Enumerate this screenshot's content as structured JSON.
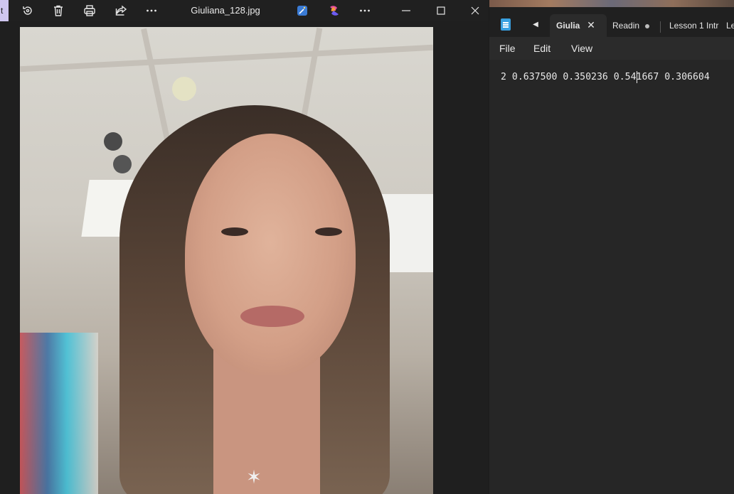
{
  "photos": {
    "title": "Giuliana_128.jpg",
    "left_accent_label": "t",
    "toolbar_icons": [
      "rotate-icon",
      "delete-icon",
      "print-icon",
      "share-icon",
      "more-icon"
    ],
    "enhance_icons": [
      "magic-wand-icon",
      "copilot-icon",
      "more-icon"
    ],
    "window_controls": [
      "minimize-icon",
      "maximize-icon",
      "close-icon"
    ]
  },
  "notepad": {
    "tabs": [
      {
        "label": "Giulia",
        "active": true
      },
      {
        "label": "Readin",
        "modified": true
      },
      {
        "label": "Lesson 1 Intr"
      },
      {
        "label": "Le"
      }
    ],
    "menu": {
      "file": "File",
      "edit": "Edit",
      "view": "View"
    },
    "content": "2 0.637500 0.350236 0.541667 0.306604",
    "close_glyph": "✕",
    "scroll_left_glyph": "◀"
  },
  "colors": {
    "notepad_icon": "#39a0e0",
    "left_accent": "#cfc6f0"
  }
}
